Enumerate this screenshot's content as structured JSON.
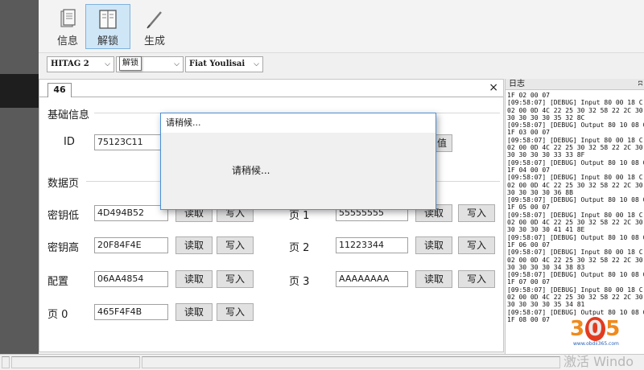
{
  "toolbar": {
    "buttons": [
      {
        "label": "信息",
        "icon": "info-document-icon"
      },
      {
        "label": "解锁",
        "icon": "book-unlock-icon"
      },
      {
        "label": "生成",
        "icon": "pen-generate-icon"
      }
    ]
  },
  "selectors": {
    "chip": "HITAG 2",
    "mode": "",
    "vehicle": "Fiat Youlisai"
  },
  "tooltip": "解锁",
  "tab": {
    "label": "46",
    "close": "×"
  },
  "basic": {
    "group_label": "基础信息",
    "id_label": "ID",
    "id_value": "75123C11",
    "partial_button": "值"
  },
  "pages": {
    "group_label": "数据页",
    "read_label": "读取",
    "write_label": "写入",
    "left_rows": [
      {
        "label": "密钥低",
        "value": "4D494B52"
      },
      {
        "label": "密钥高",
        "value": "20F84F4E"
      },
      {
        "label": "配置",
        "value": "06AA4854"
      },
      {
        "label": "页 0",
        "value": "465F4F4B"
      }
    ],
    "right_rows": [
      {
        "label": "页 1",
        "value": "55555555"
      },
      {
        "label": "页 2",
        "value": "11223344"
      },
      {
        "label": "页 3",
        "value": "AAAAAAAA"
      }
    ]
  },
  "modal": {
    "title": "请稍候...",
    "message": "请稍候..."
  },
  "log": {
    "title": "日志",
    "pin": "ʭ",
    "lines": "1F 02 00 07\n[09:58:07] [DEBUG] Input 80 00 18 C\n02 00 0D 4C 22 25 30 32 58 22 2C 30\n30 30 30 30 35 32 8C\n[09:58:07] [DEBUG] Output 80 10 08 0\n1F 03 00 07\n[09:58:07] [DEBUG] Input 80 00 18 C\n02 00 0D 4C 22 25 30 32 58 22 2C 30\n30 30 30 30 33 33 8F\n[09:58:07] [DEBUG] Output 80 10 08 0\n1F 04 00 07\n[09:58:07] [DEBUG] Input 80 00 18 C\n02 00 0D 4C 22 25 30 32 58 22 2C 30\n30 30 30 30 36 8B\n[09:58:07] [DEBUG] Output 80 10 08 0\n1F 05 00 07\n[09:58:07] [DEBUG] Input 80 00 18 C\n02 00 0D 4C 22 25 30 32 58 22 2C 30\n30 30 30 30 41 41 8E\n[09:58:07] [DEBUG] Output 80 10 08 0\n1F 06 00 07\n[09:58:07] [DEBUG] Input 80 00 18 C\n02 00 0D 4C 22 25 30 32 58 22 2C 30\n30 30 30 30 34 38 83\n[09:58:07] [DEBUG] Output 80 10 08 0\n1F 07 00 07\n[09:58:07] [DEBUG] Input 80 00 18 C\n02 00 0D 4C 22 25 30 32 58 22 2C 30\n30 30 30 30 35 34 81\n[09:58:07] [DEBUG] Output 80 10 08 0\n1F 08 00 07"
  },
  "watermark": {
    "digit1": "3",
    "digit2": "0",
    "digit3": "5",
    "site": "www.obdii365.com",
    "activate": "激活 Windo"
  },
  "colors": {
    "accent": "#4a90d9",
    "active_tool": "#cfe6f7",
    "watermark_orange": "#f08a1c",
    "watermark_red": "#e23b1f"
  }
}
